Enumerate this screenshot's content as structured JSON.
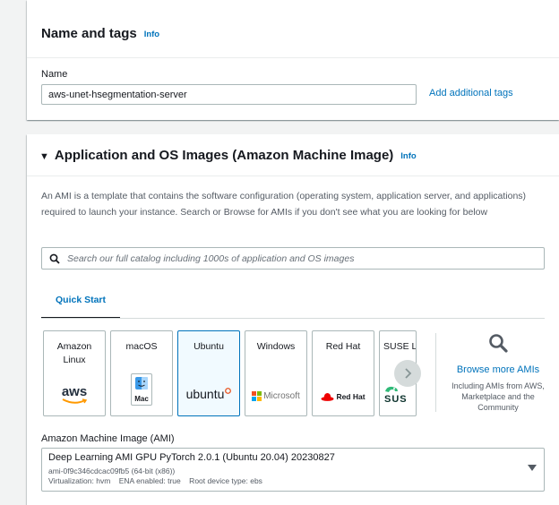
{
  "name_tags": {
    "title": "Name and tags",
    "info": "Info",
    "name_label": "Name",
    "name_value": "aws-unet-hsegmentation-server",
    "add_tags_link": "Add additional tags"
  },
  "ami_section": {
    "title": "Application and OS Images (Amazon Machine Image)",
    "info": "Info",
    "description": "An AMI is a template that contains the software configuration (operating system, application server, and applications) required to launch your instance. Search or Browse for AMIs if you don't see what you are looking for below",
    "search_placeholder": "Search our full catalog including 1000s of application and OS images",
    "tabs": [
      {
        "label": "Quick Start",
        "selected": true
      }
    ],
    "tiles": [
      {
        "name": "Amazon Linux",
        "logo": "aws",
        "selected": false
      },
      {
        "name": "macOS",
        "logo": "Mac",
        "selected": false
      },
      {
        "name": "Ubuntu",
        "logo": "ubuntu",
        "selected": true
      },
      {
        "name": "Windows",
        "logo": "Microsoft",
        "selected": false
      },
      {
        "name": "Red Hat",
        "logo": "Red Hat",
        "selected": false
      },
      {
        "name": "SUSE Li",
        "logo": "SUS",
        "selected": false
      }
    ],
    "browse_more": {
      "link": "Browse more AMIs",
      "subtext": "Including AMIs from AWS, Marketplace and the Community"
    },
    "ami_label": "Amazon Machine Image (AMI)",
    "ami_selected": {
      "name": "Deep Learning AMI GPU PyTorch 2.0.1 (Ubuntu 20.04) 20230827",
      "id_line": "ami-0f9c346cdcac09fb5 (64-bit (x86))",
      "details_line": "Virtualization: hvm    ENA enabled: true    Root device type: ebs"
    }
  },
  "colors": {
    "link": "#0073bb",
    "selected_tile_bg": "#f1faff",
    "aws_orange": "#ff9900",
    "ubuntu_orange": "#e95420",
    "redhat_red": "#ee0000",
    "suse_green": "#30ba78"
  }
}
